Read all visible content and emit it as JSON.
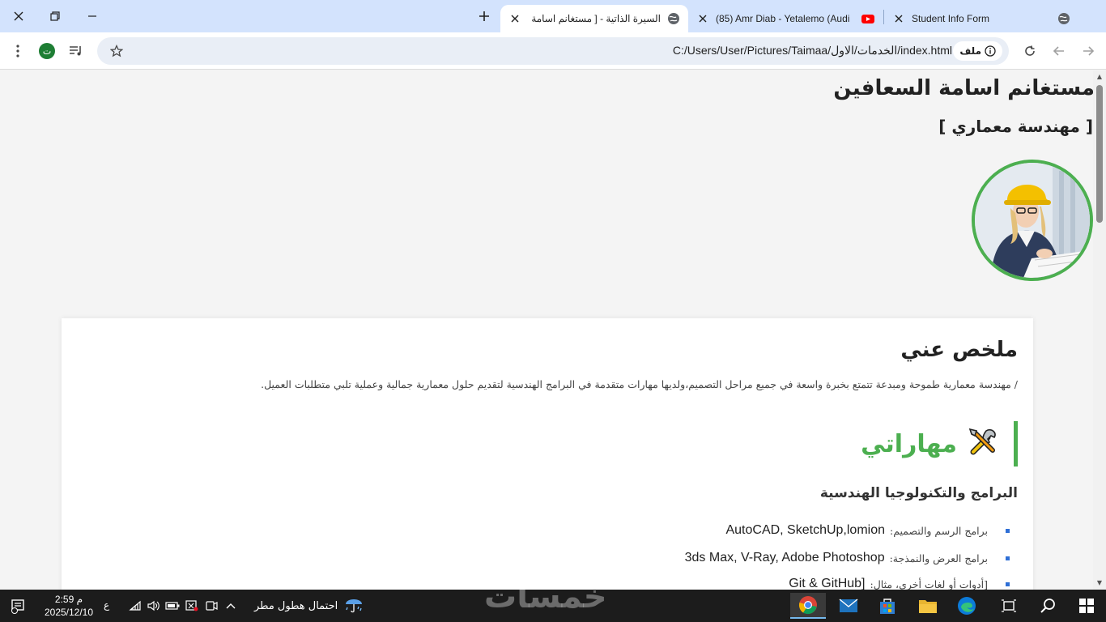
{
  "browser": {
    "tabs": [
      {
        "title": "Student Info Form",
        "favicon": "globe-icon"
      },
      {
        "title": "(85) Amr Diab - Yetalemo (Audi",
        "favicon": "youtube-icon"
      },
      {
        "title": "السيرة الذاتية - [ مستغانم اسامة ال",
        "favicon": "globe-icon",
        "active": true
      }
    ],
    "url": "C:/Users/User/Pictures/Taimaa/الخدمات/الاول/index.html",
    "site_chip": "ملف",
    "profile_initial": "ت"
  },
  "page": {
    "name": "مستغانم اسامة السعافين",
    "job_title": "[ مهندسة معماري ]",
    "photo": "engineer-photo",
    "about": {
      "title": "ملخص عني",
      "text": "/ مهندسة معمارية طموحة ومبدعة تتمتع بخبرة واسعة في جميع مراحل التصميم،ولديها مهارات متقدمة في البرامج الهندسية لتقديم حلول معمارية جمالية وعملية تلبي متطلبات العميل."
    },
    "skills": {
      "title": "مهاراتي",
      "icon": "tools-icon",
      "subtitle": "البرامج والتكنولوجيا الهندسية",
      "items": [
        {
          "label": "برامج الرسم والتصميم:",
          "value": "AutoCAD, SketchUp,lomion"
        },
        {
          "label": "برامج العرض والنمذجة:",
          "value": "3ds Max, V-Ray, Adobe Photoshop"
        },
        {
          "label": "[أدوات أو لغات أخرى، مثال:",
          "value": "Git & GitHub]"
        }
      ]
    }
  },
  "taskbar": {
    "time": "2:59 م",
    "date": "2025/12/10",
    "language": "ع",
    "weather": "احتمال هطول مطر",
    "watermark": "خمسات"
  },
  "colors": {
    "accent_green": "#4caf50",
    "bullet_blue": "#2f6fd6",
    "tabstrip": "#d3e3fd"
  }
}
